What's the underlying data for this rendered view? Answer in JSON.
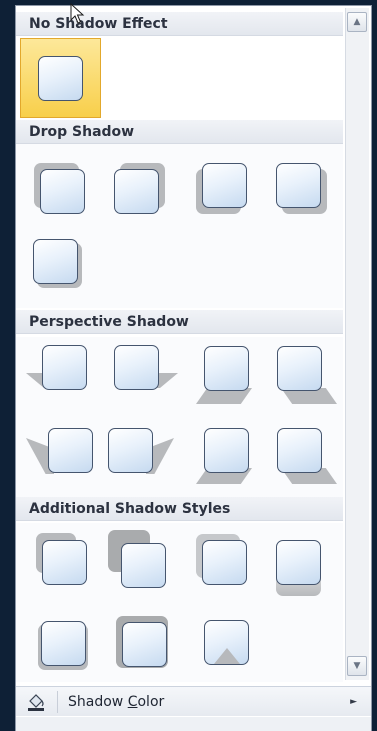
{
  "gallery": {
    "no_shadow": {
      "title": "No Shadow Effect",
      "items": [
        {
          "name": "No Shadow",
          "selected": true
        }
      ]
    },
    "drop_shadow": {
      "title": "Drop Shadow"
    },
    "perspective_shadow": {
      "title": "Perspective Shadow"
    },
    "additional": {
      "title": "Additional Shadow Styles"
    }
  },
  "footer": {
    "icon": "paint-bucket-icon",
    "label_prefix": "Shadow ",
    "label_accel": "C",
    "label_suffix": "olor",
    "arrow_icon": "submenu-arrow-icon"
  },
  "scrollbar": {
    "up_icon": "scroll-up-icon",
    "down_icon": "scroll-down-icon"
  },
  "colors": {
    "selected_fill": "#f8cf4a",
    "selected_border": "#e2a82c",
    "shadow": "#b7b9bc",
    "square_border": "#45556e"
  }
}
